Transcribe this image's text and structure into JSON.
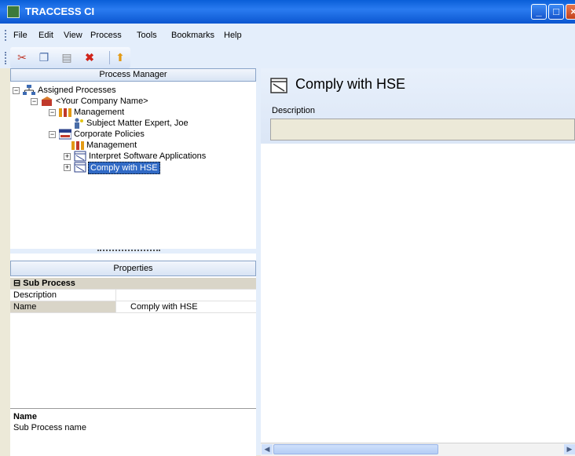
{
  "window": {
    "title": "TRACCESS CI"
  },
  "menu": [
    "File",
    "Edit",
    "View",
    "Process",
    "Tools",
    "Bookmarks",
    "Help"
  ],
  "toolbar": {
    "icons": [
      "cut-icon",
      "copy-icon",
      "paste-icon",
      "delete-icon",
      "up-icon"
    ]
  },
  "process_manager": {
    "header": "Process Manager",
    "tree": [
      {
        "label": "Assigned Processes",
        "icon": "network-icon"
      },
      {
        "label": "<Your Company Name>",
        "icon": "company-icon"
      },
      {
        "label": "Management",
        "icon": "group-icon"
      },
      {
        "label": "Subject Matter Expert, Joe",
        "icon": "person-icon"
      },
      {
        "label": "Corporate Policies",
        "icon": "folder-icon"
      },
      {
        "label": "Management",
        "icon": "group-icon"
      },
      {
        "label": "Interpret Software Applications",
        "icon": "process-icon"
      },
      {
        "label": "Comply with HSE",
        "icon": "process-icon",
        "selected": true
      }
    ]
  },
  "properties": {
    "header": "Properties",
    "category": "Sub Process",
    "rows": [
      {
        "key": "Description",
        "value": ""
      },
      {
        "key": "Name",
        "value": "Comply with HSE"
      }
    ],
    "help_name": "Name",
    "help_desc": "Sub Process name"
  },
  "detail": {
    "title": "Comply with HSE",
    "description_label": "Description",
    "description_value": ""
  },
  "colors": {
    "titlebar": "#0a5fd8",
    "selection": "#316ac5"
  }
}
